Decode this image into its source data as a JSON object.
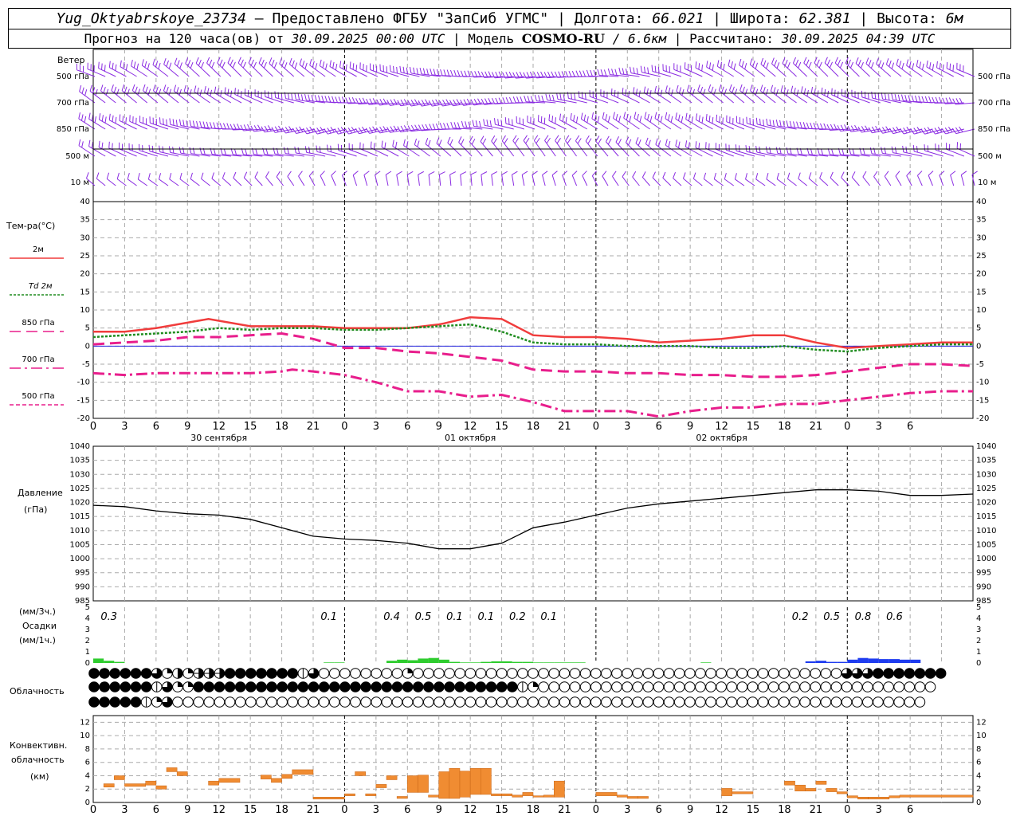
{
  "header": {
    "station": "Yug_Oktyabrskoye_23734",
    "provided": "– Предоставлено ФГБУ \"ЗапСиб УГМС\"",
    "lon_label": "Долгота:",
    "lon": "66.021",
    "lat_label": "Широта:",
    "lat": "62.381",
    "alt_label": "Высота:",
    "alt": "6м",
    "forecast_prefix": "Прогноз на 120 часа(ов) от",
    "forecast_start": "30.09.2025 00:00 UTC",
    "model_label": "Модель",
    "model": "COSMO-RU",
    "model_res": "/ 6.6км",
    "calc_label": "Рассчитано:",
    "calc_time": "30.09.2025 04:39 UTC"
  },
  "labels": {
    "wind": "Ветер",
    "wind_levels": [
      "500 гПа",
      "700 гПа",
      "850 гПа",
      "500 м",
      "10  м"
    ],
    "temp_title": "Тем-ра(°С)",
    "temp_legend": [
      "2м",
      "Td  2м",
      "850 гПа",
      "700 гПа",
      "500 гПа"
    ],
    "pressure_title": "Давление",
    "pressure_unit": "(гПа)",
    "precip_unit_3h": "(мм/3ч.)",
    "precip_title": "Осадки",
    "precip_unit_1h": "(мм/1ч.)",
    "cloud_title": "Облачность",
    "conv_title_1": "Конвективн.",
    "conv_title_2": "облачность",
    "conv_unit": "(км)"
  },
  "colors": {
    "t2m": "#f03c3c",
    "td2m": "#1e8c1e",
    "t850": "#e81e8c",
    "t700": "#e81e8c",
    "t500": "#e81e8c",
    "wind": "#8a2be2",
    "rain": "#2ecc2e",
    "rain_snow": "#1e3cf0",
    "conv": "#f08c32",
    "zero_line": "#2222dd"
  },
  "chart_data": [
    {
      "type": "line",
      "name": "temperature",
      "x_hours": [
        0,
        3,
        6,
        9,
        12,
        15,
        18,
        21,
        24,
        27,
        30,
        33,
        36,
        39,
        42,
        45,
        48,
        51,
        54,
        57,
        60,
        63,
        66,
        69,
        72
      ],
      "x_tick_labels": [
        "0",
        "3",
        "6",
        "9",
        "12",
        "15",
        "18",
        "21",
        "0",
        "3",
        "6",
        "9",
        "12",
        "15",
        "18",
        "21",
        "0",
        "3",
        "6",
        "9",
        "12",
        "15",
        "18",
        "21",
        "0",
        "3",
        "6"
      ],
      "day_labels": [
        "30 сентября",
        "01 октября",
        "02 октября"
      ],
      "ylim": [
        -20,
        40
      ],
      "y_ticks": [
        "40",
        "35",
        "30",
        "25",
        "20",
        "15",
        "10",
        "5",
        "0",
        "-5",
        "-10",
        "-15",
        "-20"
      ],
      "series": [
        {
          "name": "2м",
          "hours": [
            0,
            3,
            6,
            9,
            11,
            15,
            18,
            21,
            24,
            27,
            30,
            33,
            33.5,
            36,
            39,
            42,
            45,
            48,
            51,
            54,
            57,
            60,
            63,
            66,
            69,
            72,
            75,
            78,
            81,
            84
          ],
          "values": [
            4,
            4,
            5,
            6.5,
            7.5,
            5.5,
            5.5,
            5.5,
            5,
            5,
            5,
            6,
            6.3,
            8,
            7.5,
            3,
            2.5,
            2.5,
            2,
            1,
            1.5,
            2,
            3,
            3,
            1,
            -0.5,
            0,
            0.5,
            1,
            1
          ]
        },
        {
          "name": "Td  2м",
          "hours": [
            0,
            3,
            6,
            9,
            12,
            15,
            18,
            21,
            24,
            27,
            30,
            33,
            36,
            39,
            42,
            45,
            48,
            51,
            54,
            57,
            60,
            63,
            66,
            69,
            72,
            75,
            78,
            81,
            84
          ],
          "values": [
            2.5,
            3,
            3.5,
            4,
            5,
            4.5,
            5,
            5,
            4.5,
            4.5,
            5,
            5.5,
            6,
            4,
            1,
            0.5,
            0.5,
            0,
            0,
            0,
            -0.5,
            -0.5,
            0,
            -1,
            -1.5,
            -0.5,
            0,
            0.5,
            0.5
          ]
        },
        {
          "name": "850 гПа",
          "hours": [
            0,
            3,
            6,
            9,
            12,
            15,
            18,
            21,
            24,
            27,
            30,
            33,
            36,
            39,
            42,
            45,
            48,
            51,
            54,
            57,
            60,
            63,
            66,
            69,
            72,
            75,
            78,
            81,
            84
          ],
          "values": [
            0.5,
            1,
            1.5,
            2.5,
            2.5,
            3,
            3.5,
            2,
            -0.5,
            -0.5,
            -1.5,
            -2,
            -3,
            -4,
            -6.5,
            -7,
            -7,
            -7.5,
            -7.5,
            -8,
            -8,
            -8.5,
            -8.5,
            -8,
            -7,
            -6,
            -5,
            -5,
            -5.5
          ]
        },
        {
          "name": "700 гПа",
          "hours": [
            0,
            3,
            6,
            9,
            12,
            15,
            18,
            19,
            21,
            24,
            27,
            30,
            33,
            36,
            39,
            42,
            45,
            48,
            51,
            54,
            57,
            60,
            63,
            66,
            69,
            72,
            75,
            78,
            81,
            84
          ],
          "values": [
            -7.5,
            -8,
            -7.5,
            -7.5,
            -7.5,
            -7.5,
            -7,
            -6.5,
            -7,
            -8,
            -10,
            -12.5,
            -12.5,
            -14,
            -13.5,
            -15.5,
            -18,
            -18,
            -18,
            -19.5,
            -18,
            -17,
            -17,
            -16,
            -16,
            -15,
            -14,
            -13,
            -12.5,
            -12.5
          ]
        }
      ]
    },
    {
      "type": "line",
      "name": "pressure",
      "ylim": [
        985,
        1040
      ],
      "y_ticks": [
        "1040",
        "1035",
        "1030",
        "1025",
        "1020",
        "1015",
        "1010",
        "1005",
        "1000",
        "995",
        "990",
        "985"
      ],
      "series": [
        {
          "name": "Давление",
          "hours": [
            0,
            3,
            6,
            9,
            12,
            15,
            18,
            21,
            24,
            27,
            30,
            33,
            36,
            39,
            42,
            45,
            48,
            51,
            54,
            57,
            60,
            63,
            66,
            69,
            72,
            75,
            78,
            81,
            84
          ],
          "values": [
            1019,
            1018.5,
            1017,
            1016,
            1015.5,
            1014,
            1011,
            1008,
            1007,
            1006.5,
            1005.5,
            1003.5,
            1003.5,
            1005.5,
            1011,
            1013,
            1015.5,
            1018,
            1019.5,
            1020.5,
            1021.5,
            1022.5,
            1023.5,
            1024.5,
            1024.5,
            1024,
            1022.5,
            1022.5,
            1023
          ]
        }
      ]
    },
    {
      "type": "bar",
      "name": "precipitation",
      "ylim": [
        0,
        5
      ],
      "y_ticks": [
        "5",
        "4",
        "3",
        "2",
        "1",
        "0"
      ],
      "sum_labels": [
        {
          "hour": 1.5,
          "text": "0.3"
        },
        {
          "hour": 22.5,
          "text": "0.1"
        },
        {
          "hour": 28.5,
          "text": "0.4"
        },
        {
          "hour": 31.5,
          "text": "0.5"
        },
        {
          "hour": 34.5,
          "text": "0.1"
        },
        {
          "hour": 37.5,
          "text": "0.1"
        },
        {
          "hour": 40.5,
          "text": "0.2"
        },
        {
          "hour": 43.5,
          "text": "0.1"
        },
        {
          "hour": 67.5,
          "text": "0.2"
        },
        {
          "hour": 70.5,
          "text": "0.5"
        },
        {
          "hour": 73.5,
          "text": "0.8"
        },
        {
          "hour": 76.5,
          "text": "0.6"
        }
      ],
      "hourly_rain": [
        0.4,
        0.2,
        0.1,
        0,
        0,
        0,
        0,
        0,
        0,
        0,
        0,
        0,
        0,
        0,
        0,
        0,
        0,
        0,
        0,
        0,
        0,
        0,
        0.05,
        0.05,
        0,
        0,
        0,
        0,
        0.2,
        0.3,
        0.25,
        0.4,
        0.45,
        0.3,
        0.1,
        0.05,
        0.05,
        0.1,
        0.15,
        0.15,
        0.1,
        0.1,
        0.05,
        0.05,
        0.05,
        0.05,
        0.05,
        0,
        0,
        0,
        0,
        0,
        0,
        0,
        0,
        0,
        0,
        0,
        0.05,
        0,
        0,
        0,
        0,
        0,
        0,
        0,
        0,
        0,
        0,
        0,
        0,
        0,
        0,
        0,
        0,
        0,
        0,
        0,
        0,
        0,
        0,
        0,
        0,
        0,
        0
      ],
      "hourly_mixed": [
        0,
        0,
        0,
        0,
        0,
        0,
        0,
        0,
        0,
        0,
        0,
        0,
        0,
        0,
        0,
        0,
        0,
        0,
        0,
        0,
        0,
        0,
        0,
        0,
        0,
        0,
        0,
        0,
        0,
        0,
        0,
        0,
        0,
        0,
        0,
        0,
        0,
        0,
        0,
        0,
        0,
        0,
        0,
        0,
        0,
        0,
        0,
        0,
        0,
        0,
        0,
        0,
        0,
        0,
        0,
        0,
        0,
        0,
        0,
        0,
        0,
        0,
        0,
        0,
        0,
        0,
        0,
        0,
        0.15,
        0.2,
        0.1,
        0.1,
        0.3,
        0.45,
        0.4,
        0.35,
        0.35,
        0.3,
        0.3,
        0,
        0,
        0,
        0,
        0,
        0
      ]
    },
    {
      "type": "heatmap",
      "name": "cloudiness",
      "rows": [
        "@@@@@@dqhqfff@@@@@@@ldooooooooqoooooooooooooooooooooooooooooooooooooooooddd@@@@@@@",
        "@@@@@@ldqq@@@@@@@@@@@@@@@@@@@@@@@@@@@@@@@lqoooooooooooooooooooooooooooooooooooooo",
        "@@@@@lqdoooooooooooooooooooooooooooooooooooooooooooooooooooooooooooooooooooooooo"
      ]
    },
    {
      "type": "bar",
      "name": "convective_cloud",
      "ylim": [
        0,
        13
      ],
      "y_ticks": [
        "12",
        "10",
        "8",
        "6",
        "4",
        "2",
        "0"
      ],
      "segments": [
        [
          1,
          2,
          2.3,
          2.8
        ],
        [
          2,
          3,
          3.4,
          4
        ],
        [
          3,
          5,
          2.4,
          2.8
        ],
        [
          5,
          6,
          2.6,
          3.2
        ],
        [
          6,
          7,
          2,
          2.5
        ],
        [
          7,
          8,
          4.6,
          5.2
        ],
        [
          8,
          9,
          4,
          4.6
        ],
        [
          11,
          12,
          2.6,
          3.2
        ],
        [
          12,
          14,
          3,
          3.6
        ],
        [
          16,
          17,
          3.5,
          4.1
        ],
        [
          17,
          18,
          3,
          3.6
        ],
        [
          18,
          19,
          3.6,
          4.2
        ],
        [
          19,
          21,
          4.2,
          4.9
        ],
        [
          21,
          24,
          0.5,
          0.8
        ],
        [
          24,
          25,
          1,
          1.3
        ],
        [
          25,
          26,
          4,
          4.6
        ],
        [
          26,
          27,
          1,
          1.3
        ],
        [
          27,
          28,
          2.2,
          2.7
        ],
        [
          28,
          29,
          3.4,
          4
        ],
        [
          29,
          30,
          0.6,
          0.9
        ],
        [
          30,
          31,
          1.5,
          4
        ],
        [
          31,
          32,
          1.5,
          4.1
        ],
        [
          32,
          33,
          0.8,
          1.1
        ],
        [
          33,
          34,
          0.6,
          4.6
        ],
        [
          34,
          35,
          0.6,
          5.1
        ],
        [
          35,
          36,
          0.8,
          4.7
        ],
        [
          36,
          37,
          1.2,
          5.1
        ],
        [
          37,
          38,
          1.2,
          5.1
        ],
        [
          38,
          39,
          1,
          1.3
        ],
        [
          39,
          40,
          1,
          1.3
        ],
        [
          40,
          41,
          0.8,
          1.1
        ],
        [
          41,
          42,
          1,
          1.5
        ],
        [
          42,
          43,
          0.8,
          1
        ],
        [
          43,
          44,
          0.8,
          1.1
        ],
        [
          44,
          45,
          0.8,
          3.2
        ],
        [
          48,
          50,
          1,
          1.5
        ],
        [
          50,
          51,
          0.8,
          1.1
        ],
        [
          51,
          52,
          0.6,
          0.9
        ],
        [
          52,
          53,
          0.6,
          0.9
        ],
        [
          60,
          61,
          1,
          2.1
        ],
        [
          61,
          63,
          1.3,
          1.6
        ],
        [
          66,
          67,
          2.6,
          3.2
        ],
        [
          67,
          68,
          1.7,
          2.6
        ],
        [
          68,
          69,
          1.7,
          2.1
        ],
        [
          69,
          70,
          2.7,
          3.2
        ],
        [
          70,
          71,
          1.6,
          2.1
        ],
        [
          71,
          72,
          1.3,
          1.6
        ],
        [
          72,
          73,
          0.7,
          1
        ],
        [
          73,
          74,
          0.5,
          0.8
        ],
        [
          74,
          76,
          0.5,
          0.8
        ],
        [
          76,
          77,
          0.7,
          1
        ],
        [
          77,
          84,
          0.8,
          1.1
        ]
      ]
    }
  ]
}
